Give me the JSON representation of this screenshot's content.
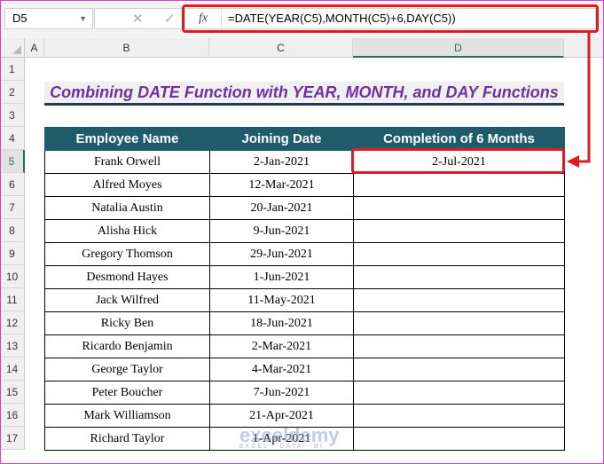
{
  "name_box": "D5",
  "formula": "=DATE(YEAR(C5),MONTH(C5)+6,DAY(C5))",
  "fx_label": "fx",
  "columns": [
    "A",
    "B",
    "C",
    "D"
  ],
  "rows": [
    "1",
    "2",
    "3",
    "4",
    "5",
    "6",
    "7",
    "8",
    "9",
    "10",
    "11",
    "12",
    "13",
    "14",
    "15",
    "16",
    "17"
  ],
  "title": "Combining DATE Function with YEAR, MONTH, and DAY Functions",
  "headers": [
    "Employee Name",
    "Joining Date",
    "Completion of 6 Months"
  ],
  "data": [
    [
      "Frank Orwell",
      "2-Jan-2021",
      "2-Jul-2021"
    ],
    [
      "Alfred Moyes",
      "12-Mar-2021",
      ""
    ],
    [
      "Natalia Austin",
      "20-Jan-2021",
      ""
    ],
    [
      "Alisha Hick",
      "9-Jun-2021",
      ""
    ],
    [
      "Gregory Thomson",
      "29-Jun-2021",
      ""
    ],
    [
      "Desmond Hayes",
      "1-Jun-2021",
      ""
    ],
    [
      "Jack Wilfred",
      "11-May-2021",
      ""
    ],
    [
      "Ricky Ben",
      "18-Jun-2021",
      ""
    ],
    [
      "Ricardo Benjamin",
      "2-Mar-2021",
      ""
    ],
    [
      "George Taylor",
      "4-Mar-2021",
      ""
    ],
    [
      "Peter Boucher",
      "7-Jun-2021",
      ""
    ],
    [
      "Mark Williamson",
      "21-Apr-2021",
      ""
    ],
    [
      "Richard Taylor",
      "1-Apr-2021",
      ""
    ]
  ],
  "watermark": "exceldemy",
  "watermark_sub": "EXCEL · DATA · BI"
}
